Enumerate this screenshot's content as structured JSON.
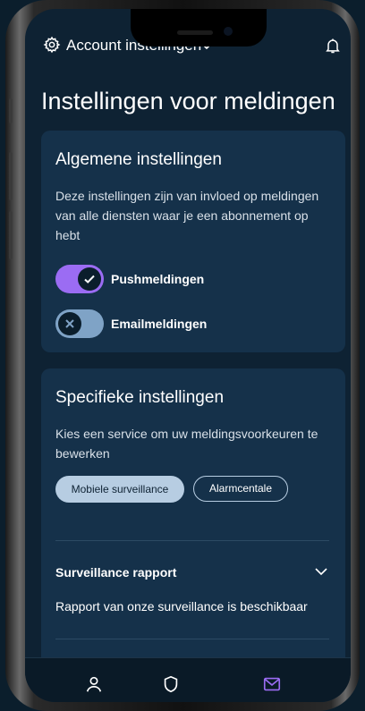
{
  "header": {
    "account_label": "Account instellingen"
  },
  "page": {
    "title": "Instellingen voor meldingen"
  },
  "general": {
    "title": "Algemene instellingen",
    "description": "Deze instellingen zijn van invloed op meldingen van alle diensten waar je een abonnement op hebt",
    "toggles": [
      {
        "label": "Pushmeldingen",
        "enabled": true
      },
      {
        "label": "Emailmeldingen",
        "enabled": false
      }
    ]
  },
  "specific": {
    "title": "Specifieke instellingen",
    "description": "Kies een service om uw meldingsvoorkeuren te bewerken",
    "services": [
      {
        "label": "Mobiele surveillance",
        "selected": true
      },
      {
        "label": "Alarmcentale",
        "selected": false
      }
    ],
    "accordion": {
      "title": "Surveillance rapport",
      "body": "Rapport van onze surveillance is beschikbaar"
    }
  },
  "nav": {
    "items": [
      {
        "icon": "user-icon",
        "active": false
      },
      {
        "icon": "shield-icon",
        "active": false
      },
      {
        "icon": "mail-icon",
        "active": true
      }
    ]
  },
  "colors": {
    "accent": "#9b6cf3",
    "background": "#0e2233",
    "card": "#15314a"
  }
}
